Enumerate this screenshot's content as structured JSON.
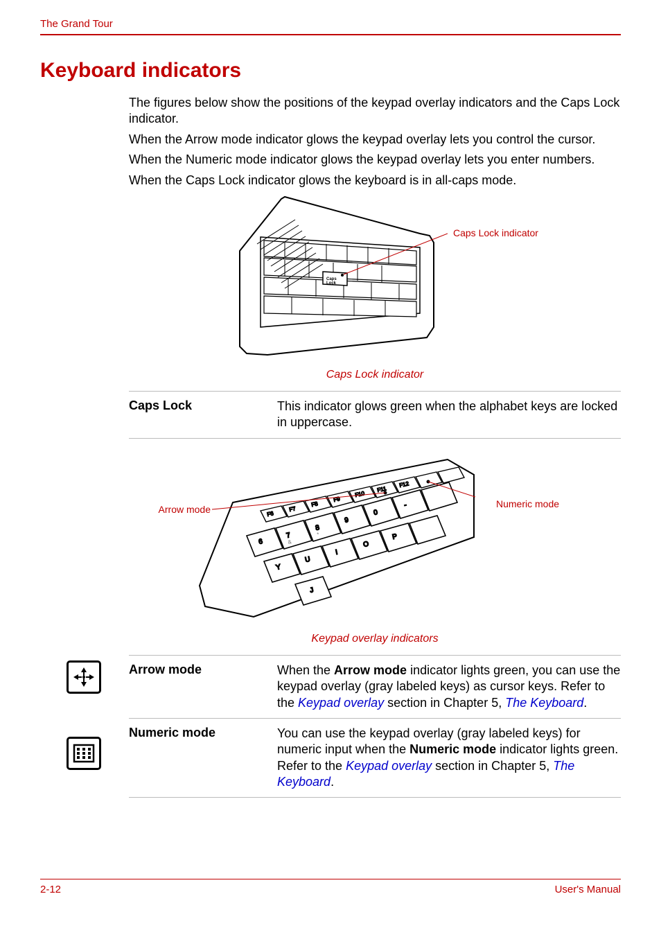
{
  "header": {
    "section": "The Grand Tour"
  },
  "heading": "Keyboard indicators",
  "intro": {
    "p1": "The figures below show the positions of the keypad overlay indicators and the Caps Lock indicator.",
    "p2": "When the Arrow mode indicator glows the keypad overlay lets you control the cursor.",
    "p3": "When the Numeric mode indicator glows the keypad overlay lets you enter numbers.",
    "p4": "When the Caps Lock indicator glows the keyboard is in all-caps mode."
  },
  "figure1": {
    "label_capslock": "Caps Lock indicator",
    "caption": "Caps Lock indicator"
  },
  "table1": {
    "row0": {
      "term": "Caps Lock",
      "desc": "This indicator glows green when the alphabet keys are locked in uppercase."
    }
  },
  "figure2": {
    "label_arrow": "Arrow mode",
    "label_numeric": "Numeric mode",
    "caption": "Keypad overlay indicators"
  },
  "table2": {
    "row0": {
      "term": "Arrow mode",
      "desc_prefix": "When the ",
      "desc_bold": "Arrow mode",
      "desc_mid": " indicator lights green, you can use the keypad overlay (gray labeled keys) as cursor keys. Refer to the ",
      "link1": "Keypad overlay",
      "desc_mid2": " section in Chapter 5, ",
      "link2": "The Keyboard",
      "desc_suffix": "."
    },
    "row1": {
      "term": "Numeric mode",
      "desc_prefix": "You can use the keypad overlay (gray labeled keys) for numeric input when the ",
      "desc_bold": "Numeric mode",
      "desc_mid": " indicator lights green. Refer to the ",
      "link1": "Keypad overlay",
      "desc_mid2": " section in Chapter 5, ",
      "link2": "The Keyboard",
      "desc_suffix": "."
    }
  },
  "footer": {
    "pagenum": "2-12",
    "manual": "User's Manual"
  }
}
